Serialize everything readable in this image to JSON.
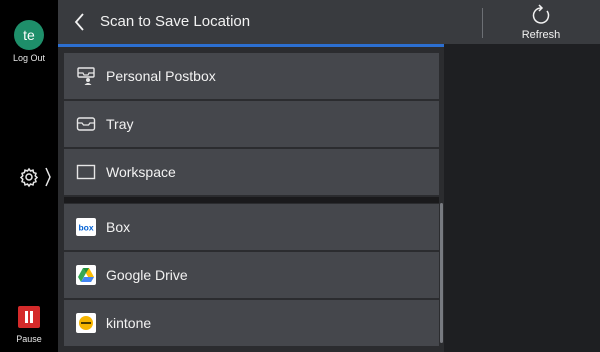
{
  "rail": {
    "avatar_initials": "te",
    "logout_label": "Log Out",
    "pause_label": "Pause",
    "pause_color": "#d42a2a",
    "avatar_color": "#1e8f6a"
  },
  "header": {
    "title": "Scan to Save Location",
    "refresh_label": "Refresh",
    "accent_color": "#2c6fd1"
  },
  "list": {
    "group1": [
      {
        "label": "Personal Postbox",
        "icon": "postbox-icon"
      },
      {
        "label": "Tray",
        "icon": "tray-icon"
      },
      {
        "label": "Workspace",
        "icon": "workspace-icon"
      }
    ],
    "group2": [
      {
        "label": "Box",
        "icon": "box-logo-icon"
      },
      {
        "label": "Google Drive",
        "icon": "google-drive-icon"
      },
      {
        "label": "kintone",
        "icon": "kintone-icon"
      }
    ]
  }
}
